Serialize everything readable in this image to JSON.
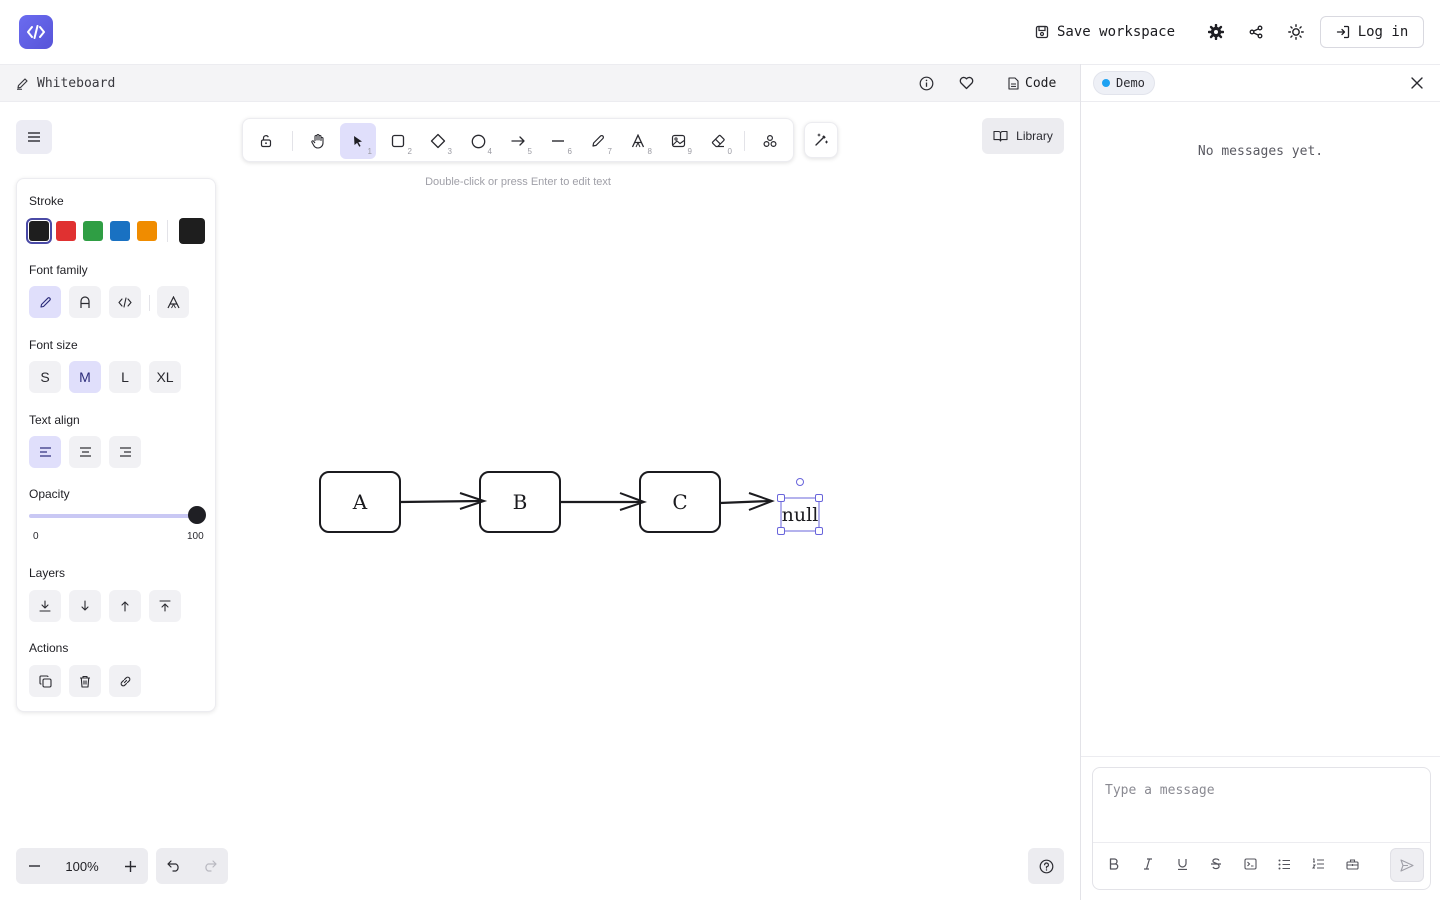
{
  "topbar": {
    "save_label": "Save workspace",
    "login_label": "Log in"
  },
  "subbar": {
    "title": "Whiteboard",
    "code_label": "Code"
  },
  "chat": {
    "badge": "Demo",
    "empty": "No messages yet.",
    "placeholder": "Type a message"
  },
  "toolbar": {
    "tools": [
      {
        "name": "lock",
        "key": ""
      },
      {
        "name": "hand",
        "key": ""
      },
      {
        "name": "selection",
        "key": "1"
      },
      {
        "name": "rectangle",
        "key": "2"
      },
      {
        "name": "diamond",
        "key": "3"
      },
      {
        "name": "ellipse",
        "key": "4"
      },
      {
        "name": "arrow",
        "key": "5"
      },
      {
        "name": "line",
        "key": "6"
      },
      {
        "name": "draw",
        "key": "7"
      },
      {
        "name": "text",
        "key": "8"
      },
      {
        "name": "image",
        "key": "9"
      },
      {
        "name": "eraser",
        "key": "0"
      },
      {
        "name": "more-tools",
        "key": ""
      }
    ],
    "hint": "Double-click or press Enter to edit text",
    "library_label": "Library"
  },
  "props": {
    "stroke_label": "Stroke",
    "stroke_colors": [
      "#1e1e1e",
      "#e03131",
      "#2f9e44",
      "#1971c2",
      "#f08c00"
    ],
    "current_stroke": "#1e1e1e",
    "font_family_label": "Font family",
    "font_size_label": "Font size",
    "font_sizes": [
      "S",
      "M",
      "L",
      "XL"
    ],
    "font_size_selected": "M",
    "text_align_label": "Text align",
    "opacity_label": "Opacity",
    "opacity_min": "0",
    "opacity_max": "100",
    "opacity_value": 100,
    "layers_label": "Layers",
    "actions_label": "Actions"
  },
  "drawing": {
    "nodes": [
      "A",
      "B",
      "C"
    ],
    "tail_text": "null"
  },
  "zoom": {
    "value": "100%"
  },
  "accent": "#6965db"
}
